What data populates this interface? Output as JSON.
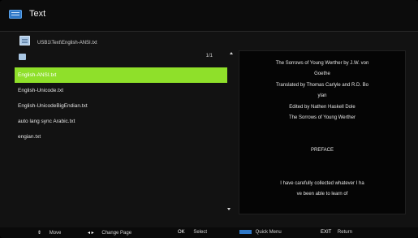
{
  "header": {
    "title": "Text",
    "icon": "text-app-icon"
  },
  "path": {
    "icon": "file-icon",
    "text": "USB1\\Text\\English-ANSI.txt"
  },
  "list": {
    "page_indicator": "1/1",
    "up_icon": "folder-up-icon",
    "items": [
      {
        "label": "English-ANSI.txt",
        "selected": true
      },
      {
        "label": "English-Unicode.txt",
        "selected": false
      },
      {
        "label": "English-UnicodeBigEndian.txt",
        "selected": false
      },
      {
        "label": "auto lang sync Arabic.txt",
        "selected": false
      },
      {
        "label": "engian.txt",
        "selected": false
      }
    ]
  },
  "preview": {
    "lines": [
      "The Sorrows of Young Werther by J.W. von",
      "Goethe",
      "Translated by Thomas Carlyle and R.D. Bo",
      "ylan",
      "Edited by Nathen Haskell Dole",
      "The Sorrows of Young Werther",
      "PREFACE",
      "I have carefully collected whatever I ha",
      "ve been able to learn of"
    ]
  },
  "footer": {
    "move_key": "⇕",
    "move_label": "Move",
    "page_key": "◂ ▸",
    "page_label": "Change Page",
    "ok_key": "OK",
    "ok_label": "Select",
    "menu_label": "Quick Menu",
    "exit_key": "EXIT",
    "exit_label": "Return"
  },
  "colors": {
    "selected_bg": "#8fe02a",
    "accent_blue": "#2f78c7",
    "background": "#121212"
  }
}
